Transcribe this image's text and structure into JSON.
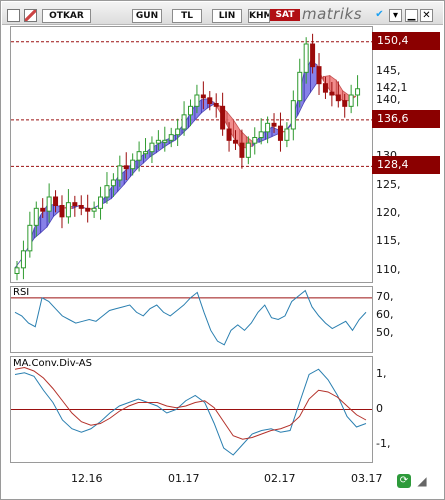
{
  "toolbar": {
    "symbol": "OTKAR",
    "period": "GUN",
    "currency": "TL",
    "scale": "LIN",
    "khm": "KHM",
    "signal": "SAT",
    "brand": "matriks",
    "left_icon": "window-icon",
    "flag_icon": "flag-icon"
  },
  "price_axis": {
    "ticks": [
      "145,",
      "140,",
      "130,",
      "125,",
      "120,",
      "115,",
      "110,"
    ],
    "tags": [
      {
        "label": "150,4",
        "value": 150.4,
        "color": "#8b0000"
      },
      {
        "label": "142,1",
        "value": 142.1,
        "color": "none"
      },
      {
        "label": "136,6",
        "value": 136.6,
        "color": "#8b0000"
      },
      {
        "label": "128,4",
        "value": 128.4,
        "color": "#8b0000"
      }
    ]
  },
  "rsi": {
    "label": "RSI",
    "ticks": [
      "70,",
      "60,",
      "50,"
    ],
    "threshold": 70
  },
  "macd": {
    "label": "MA.Conv.Div-AS",
    "ticks": [
      "1,",
      "0",
      "-1,"
    ]
  },
  "x_labels": [
    "12.16",
    "01.17",
    "02.17",
    "03.17"
  ],
  "colors": {
    "up_candle": "#2f9a2f",
    "down_candle": "#9b0a0a",
    "band_fill_up": "#7b74e6",
    "band_fill_down": "#f08080",
    "rsi_line": "#2a7fb0",
    "macd_line": "#2a7fb0",
    "signal_line": "#b4312a",
    "ref_line": "#9b1010"
  },
  "chart_data": [
    {
      "type": "candlestick",
      "title": "OTKAR",
      "ylim": [
        108,
        153
      ],
      "reference_lines": [
        150.4,
        136.6,
        128.4
      ],
      "last": 142.1,
      "close_series": [
        110.5,
        113.5,
        118,
        121,
        120.5,
        123,
        121.5,
        119.5,
        122,
        121.5,
        121,
        120.5,
        121,
        123,
        125,
        126,
        128.5,
        128,
        129.5,
        131,
        131,
        132.5,
        133,
        133,
        134,
        135,
        137.5,
        139,
        141,
        140.5,
        139.5,
        139,
        135,
        133,
        132.5,
        130,
        132.5,
        133.5,
        134.5,
        136,
        135.5,
        133,
        135,
        140,
        145,
        150,
        146,
        143,
        141.5,
        141,
        140,
        139,
        141,
        142.1
      ]
    },
    {
      "type": "line",
      "title": "RSI",
      "ylim": [
        40,
        76
      ],
      "reference_lines": [
        70
      ],
      "values": [
        62,
        60,
        56,
        54,
        70,
        68,
        64,
        60,
        58,
        56,
        57,
        58,
        57,
        60,
        63,
        64,
        65,
        66,
        62,
        60,
        64,
        66,
        62,
        60,
        63,
        66,
        70,
        73,
        62,
        52,
        46,
        44,
        52,
        55,
        52,
        56,
        62,
        66,
        59,
        58,
        60,
        68,
        71,
        74,
        65,
        60,
        56,
        53,
        55,
        57,
        52,
        58,
        62
      ]
    },
    {
      "type": "line",
      "title": "MA.Conv.Div-AS",
      "ylim": [
        -1.5,
        1.5
      ],
      "reference_lines": [
        0
      ],
      "series": [
        {
          "values": [
            1.0,
            1.05,
            0.95,
            0.55,
            0.2,
            -0.3,
            -0.55,
            -0.65,
            -0.55,
            -0.35,
            -0.1,
            0.1,
            0.2,
            0.3,
            0.2,
            0.1,
            -0.1,
            0.0,
            0.25,
            0.4,
            0.2,
            -0.4,
            -1.1,
            -1.3,
            -1.0,
            -0.7,
            -0.6,
            -0.55,
            -0.65,
            -0.6,
            0.2,
            1.0,
            1.15,
            0.85,
            0.4,
            -0.2,
            -0.5,
            -0.4
          ]
        },
        {
          "values": [
            1.15,
            1.2,
            1.1,
            0.9,
            0.6,
            0.25,
            -0.1,
            -0.35,
            -0.45,
            -0.4,
            -0.25,
            -0.05,
            0.1,
            0.2,
            0.2,
            0.2,
            0.1,
            0.05,
            0.1,
            0.2,
            0.25,
            0.05,
            -0.35,
            -0.75,
            -0.85,
            -0.8,
            -0.7,
            -0.6,
            -0.55,
            -0.45,
            -0.2,
            0.3,
            0.55,
            0.5,
            0.35,
            0.1,
            -0.15,
            -0.3
          ]
        }
      ]
    }
  ]
}
